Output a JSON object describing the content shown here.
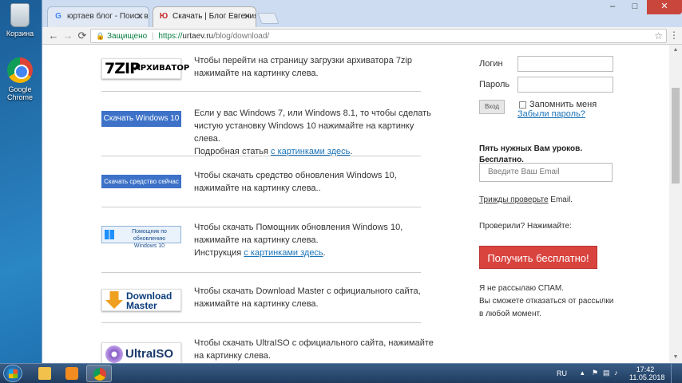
{
  "desktop": {
    "icons": [
      {
        "label": "Корзина",
        "icon": "recycle-bin-icon"
      },
      {
        "label": "Google Chrome",
        "icon": "chrome-icon"
      }
    ]
  },
  "browser": {
    "tabs": [
      {
        "title": "юртаев блог - Поиск в G",
        "icon": "G",
        "active": false
      },
      {
        "title": "Скачать | Блог Евгения Ю",
        "icon": "Ю",
        "active": true
      }
    ],
    "window_controls": {
      "minimize": "–",
      "maximize": "□",
      "close": "✕"
    },
    "address": {
      "secure_label": "Защищено",
      "protocol": "https://",
      "host": "urtaev.ru",
      "path": "/blog/download/"
    }
  },
  "content": {
    "items": [
      {
        "logo": {
          "big": "7ZIP",
          "small": "АРХИВАТОР"
        },
        "text": "Чтобы перейти на страницу загрузки архиватора 7zip нажимайте на картинку слева."
      },
      {
        "logo": {
          "label": "Скачать Windows 10"
        },
        "text": "Если у вас Windows 7, или Windows 8.1, то чтобы сделать чистую установку Windows 10 нажимайте на картинку слева.",
        "extra_prefix": "Подробная статья ",
        "link": "с картинками здесь",
        "extra_suffix": "."
      },
      {
        "logo": {
          "label": "Скачать средство сейчас"
        },
        "text": "Чтобы скачать средство обновления Windows 10, нажимайте на картинку слева.."
      },
      {
        "logo": {
          "line1": "Помощник по обновлению",
          "line2": "Windows 10"
        },
        "text": "Чтобы скачать Помощник обновления Windows 10, нажимайте на картинку слева.",
        "extra_prefix": "Инструкция ",
        "link": "с картинками здесь",
        "extra_suffix": "."
      },
      {
        "logo": {
          "line1": "Download",
          "line2": "Master"
        },
        "text": "Чтобы скачать Download Master с официального сайта, нажимайте на картинку слева."
      },
      {
        "logo": {
          "label": "UltraISO"
        },
        "text": "Чтобы скачать UltraISO с официального сайта, нажимайте на картинку слева."
      }
    ]
  },
  "sidebar": {
    "login_label": "Логин",
    "password_label": "Пароль",
    "login_button": "Вход",
    "remember": "Запомнить меня",
    "forgot": "Забыли пароль?",
    "heading": "Пять нужных Вам уроков. Бесплатно.",
    "email_placeholder": "Введите Ваш Email",
    "verify_link": "Трижды проверьте",
    "verify_suffix": " Email.",
    "checked": "Проверили? Нажимайте:",
    "cta": "Получить бесплатно!",
    "nospam_1": "Я не рассылаю СПАМ.",
    "nospam_2": "Вы сможете отказаться от рассылки в любой момент."
  },
  "taskbar": {
    "lang": "RU",
    "time": "17:42",
    "date": "11.05.2018"
  },
  "colors": {
    "accent_blue": "#3d72c8",
    "cta_red": "#d9443f",
    "link": "#1a73b8",
    "secure_green": "#0b8043"
  }
}
